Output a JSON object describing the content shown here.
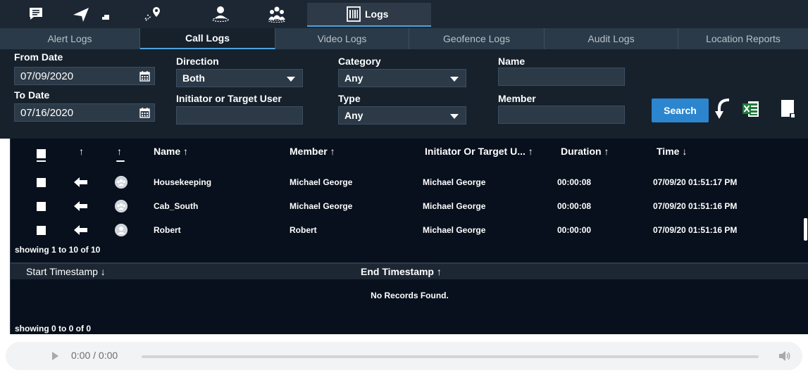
{
  "top_nav": {
    "icons": [
      "messages-icon",
      "navigation-icon",
      "geofence-icon",
      "location-users-icon",
      "groups-icon"
    ],
    "logs_tab": "Logs"
  },
  "sub_tabs": [
    {
      "label": "Alert Logs",
      "active": false
    },
    {
      "label": "Call Logs",
      "active": true
    },
    {
      "label": "Video Logs",
      "active": false
    },
    {
      "label": "Geofence Logs",
      "active": false
    },
    {
      "label": "Audit Logs",
      "active": false
    },
    {
      "label": "Location Reports",
      "active": false
    }
  ],
  "filters": {
    "from_date_label": "From Date",
    "from_date": "07/09/2020",
    "to_date_label": "To Date",
    "to_date": "07/16/2020",
    "direction_label": "Direction",
    "direction": "Both",
    "initiator_label": "Initiator or Target User",
    "initiator_value": "",
    "category_label": "Category",
    "category": "Any",
    "type_label": "Type",
    "type": "Any",
    "name_label": "Name",
    "name_value": "",
    "member_label": "Member",
    "member_value": "",
    "search_label": "Search"
  },
  "calls_table": {
    "sort_up": "↑",
    "sort_down": "↓",
    "headers": {
      "name": "Name ↑",
      "member": "Member ↑",
      "initiator": "Initiator Or Target U... ↑",
      "duration": "Duration ↑",
      "time": "Time ↓"
    },
    "rows": [
      {
        "name": "Housekeeping",
        "member": "Michael George",
        "initiator": "Michael George",
        "duration": "00:00:08",
        "time": "07/09/20 01:51:17 PM",
        "avatar": "group"
      },
      {
        "name": "Cab_South",
        "member": "Michael George",
        "initiator": "Michael George",
        "duration": "00:00:08",
        "time": "07/09/20 01:51:16 PM",
        "avatar": "group"
      },
      {
        "name": "Robert",
        "member": "Robert",
        "initiator": "Michael George",
        "duration": "00:00:00",
        "time": "07/09/20 01:51:16 PM",
        "avatar": "user"
      }
    ],
    "count_text": "showing 1 to 10 of 10"
  },
  "timestamps_table": {
    "start_header": "Start Timestamp ↓",
    "end_header": "End Timestamp ↑",
    "empty_text": "No Records Found.",
    "count_text": "showing 0 to 0 of 0"
  },
  "audio": {
    "time": "0:00 / 0:00"
  },
  "colors": {
    "dark_bg": "#07101c",
    "panel_bg": "#16212c",
    "accent": "#2c86cf",
    "excel_green": "#1f7a3c"
  }
}
